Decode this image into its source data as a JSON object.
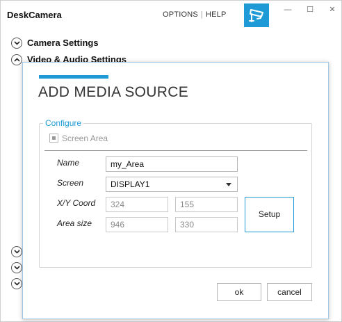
{
  "app": {
    "title": "DeskCamera",
    "menu": {
      "options": "OPTIONS",
      "separator": "|",
      "help": "HELP"
    },
    "brand_icon": "security-camera-icon",
    "accent_color": "#1e9bd7",
    "window_controls": {
      "minimize": "—",
      "maximize": "☐",
      "close": "✕"
    }
  },
  "sections": [
    {
      "label": "Camera Settings",
      "icon": "chevron-down-icon"
    },
    {
      "label": "Video & Audio Settings",
      "icon": "chevron-up-icon"
    }
  ],
  "dialog": {
    "title": "ADD MEDIA SOURCE",
    "group_label": "Configure",
    "screen_area": {
      "label": "Screen Area",
      "checked": true,
      "disabled": true
    },
    "fields": {
      "name": {
        "label": "Name",
        "value": "my_Area"
      },
      "screen": {
        "label": "Screen",
        "value": "DISPLAY1"
      },
      "xy_coord": {
        "label": "X/Y Coord",
        "x": "324",
        "y": "155"
      },
      "area_size": {
        "label": "Area size",
        "width": "946",
        "height": "330"
      }
    },
    "setup_button": "Setup",
    "ok_button": "ok",
    "cancel_button": "cancel"
  }
}
